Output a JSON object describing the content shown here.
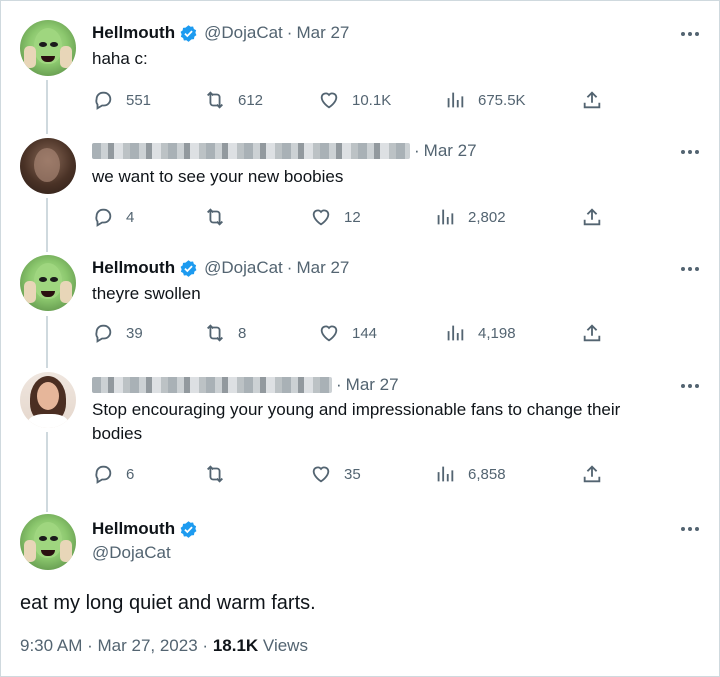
{
  "tweets": [
    {
      "name": "Hellmouth",
      "handle": "@DojaCat",
      "date": "Mar 27",
      "text": "haha c:",
      "stats": {
        "replies": "551",
        "retweets": "612",
        "likes": "10.1K",
        "views": "675.5K"
      }
    },
    {
      "date": "Mar 27",
      "text": "we want to see your new boobies",
      "stats": {
        "replies": "4",
        "retweets": "",
        "likes": "12",
        "views": "2,802"
      }
    },
    {
      "name": "Hellmouth",
      "handle": "@DojaCat",
      "date": "Mar 27",
      "text": "theyre swollen",
      "stats": {
        "replies": "39",
        "retweets": "8",
        "likes": "144",
        "views": "4,198"
      }
    },
    {
      "date": "Mar 27",
      "text_line1": "Stop encouraging your young and impressionable fans to change their",
      "text_line2": "bodies",
      "stats": {
        "replies": "6",
        "retweets": "",
        "likes": "35",
        "views": "6,858"
      }
    }
  ],
  "main_tweet": {
    "name": "Hellmouth",
    "handle": "@DojaCat",
    "text": "eat my long quiet and warm farts.",
    "time": "9:30 AM",
    "date": "Mar 27, 2023",
    "views_count": "18.1K",
    "views_label": "Views"
  },
  "colors": {
    "verified": "#1d9bf0",
    "muted": "#536471",
    "text": "#0f1419",
    "line": "#cfd9de"
  },
  "icons": [
    "reply-icon",
    "retweet-icon",
    "like-icon",
    "views-icon",
    "share-icon",
    "more-icon",
    "verified-badge-icon"
  ]
}
